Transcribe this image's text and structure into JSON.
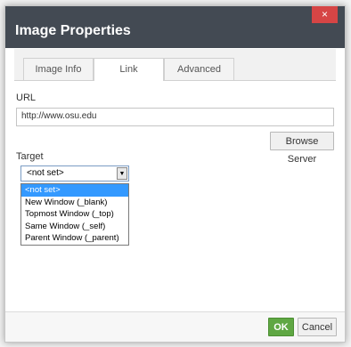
{
  "dialog": {
    "title": "Image Properties",
    "close_icon": "×"
  },
  "tabs": [
    {
      "label": "Image Info",
      "active": false
    },
    {
      "label": "Link",
      "active": true
    },
    {
      "label": "Advanced",
      "active": false
    }
  ],
  "link": {
    "url_label": "URL",
    "url_value": "http://www.osu.edu",
    "browse_label": "Browse Server",
    "target_label": "Target",
    "target_value": "<not set>",
    "target_options": [
      "<not set>",
      "New Window (_blank)",
      "Topmost Window (_top)",
      "Same Window (_self)",
      "Parent Window (_parent)"
    ]
  },
  "footer": {
    "ok_label": "OK",
    "cancel_label": "Cancel"
  },
  "colors": {
    "titlebar": "#434a53",
    "ok_button": "#5fa743",
    "close_button": "#d64545",
    "selected_option": "#3399ff"
  }
}
